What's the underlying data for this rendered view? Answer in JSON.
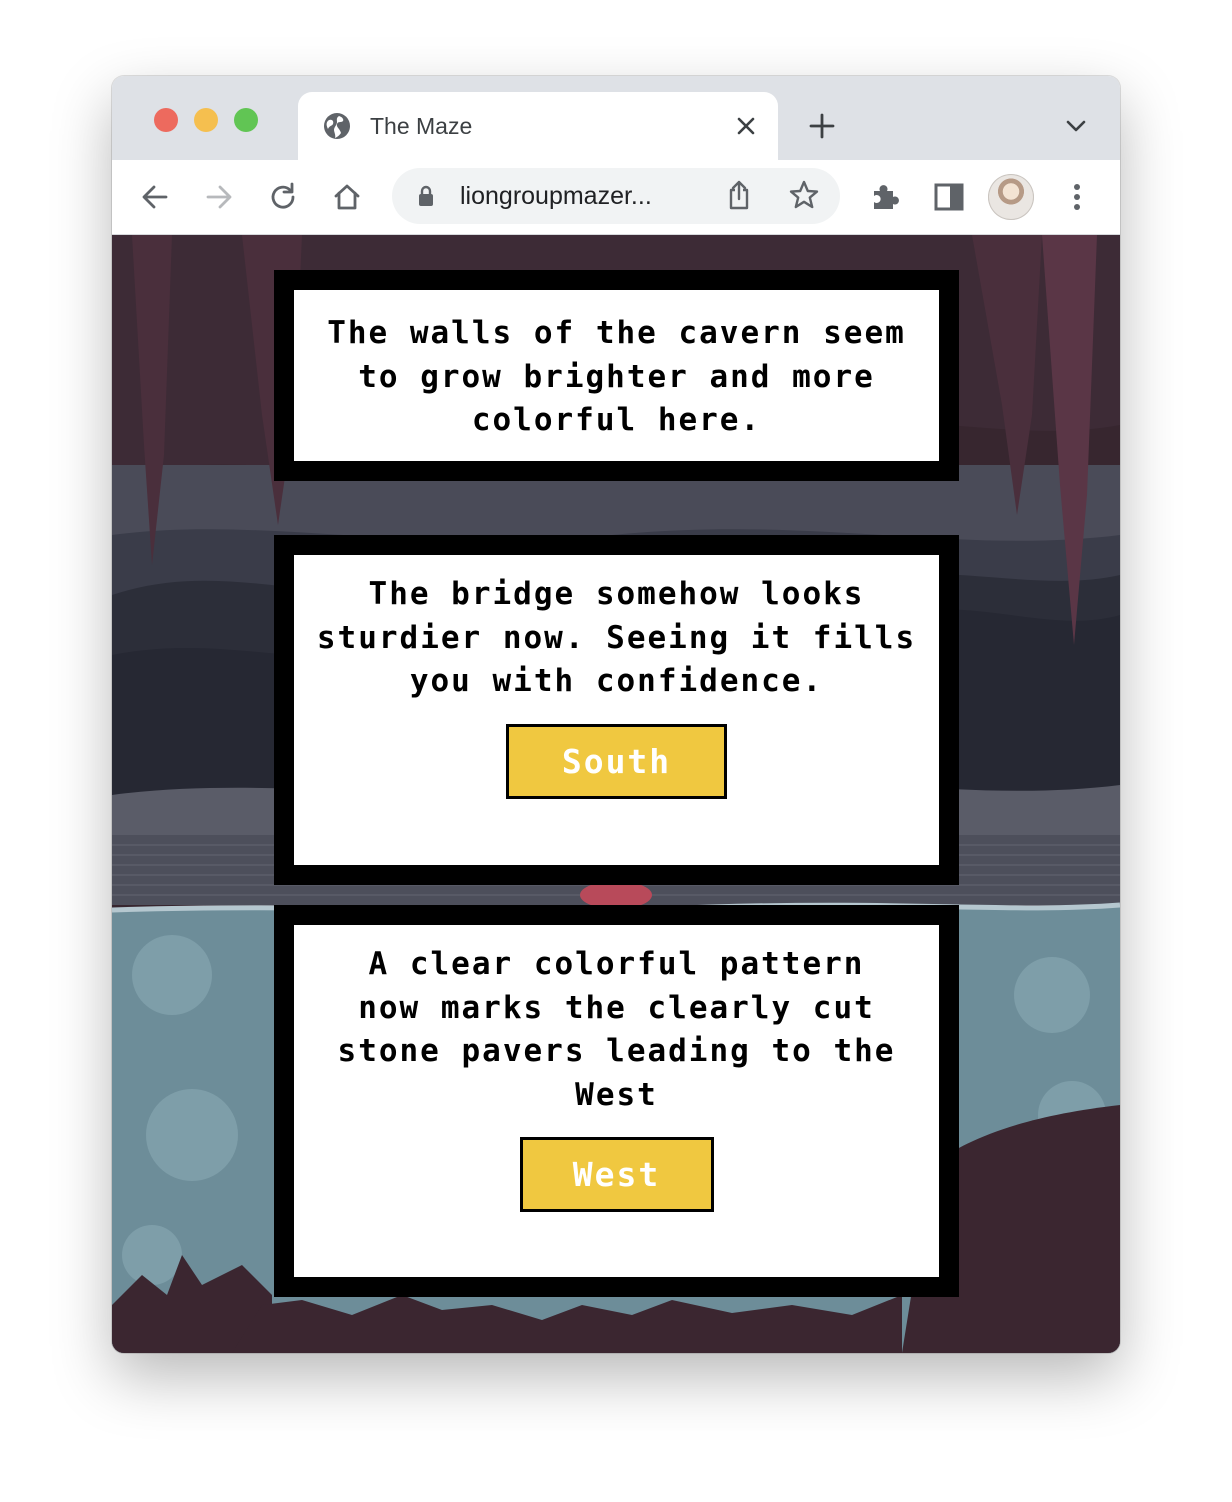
{
  "browser": {
    "tab_title": "The Maze",
    "url": "liongroupmazer..."
  },
  "icons": {
    "tab": "globe-icon",
    "close": "close-icon",
    "new_tab": "plus-icon",
    "tab_menu": "chevron-down-icon",
    "back": "back-arrow-icon",
    "forward": "forward-arrow-icon",
    "reload": "reload-icon",
    "home": "home-icon",
    "lock": "lock-icon",
    "share": "share-icon",
    "bookmark": "star-icon",
    "extensions": "puzzle-icon",
    "side_panel": "side-panel-icon",
    "profile": "avatar",
    "menu": "kebab-menu-icon"
  },
  "story": {
    "cards": [
      {
        "text": "The walls of the cavern seem to grow brighter and more colorful here."
      },
      {
        "text": "The bridge somehow looks sturdier now. Seeing it fills you with confidence.",
        "button": "South"
      },
      {
        "text": "A clear colorful pattern now marks the clearly cut stone pavers leading to the West",
        "button": "West"
      }
    ]
  },
  "colors": {
    "button_fill": "#f0c840",
    "button_text": "#ffffff",
    "card_border": "#000000",
    "card_fill": "#ffffff",
    "cave_dark": "#37262f",
    "water": "#6d8d99"
  }
}
